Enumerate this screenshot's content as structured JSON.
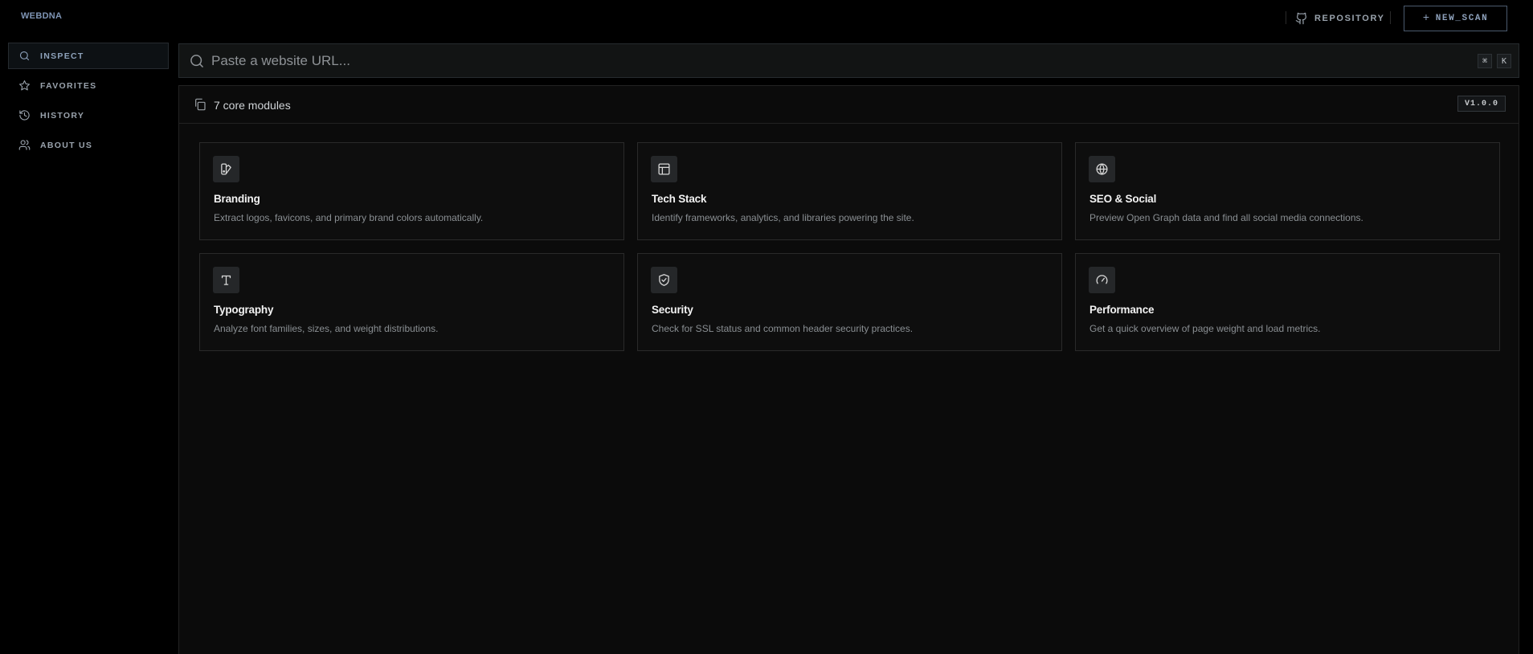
{
  "brand": "WEBDNA",
  "header": {
    "repository_label": "REPOSITORY",
    "new_scan_label": "NEW_SCAN",
    "new_scan_icon": "plus-icon",
    "repository_icon": "github-icon"
  },
  "sidebar": {
    "items": [
      {
        "label": "INSPECT",
        "icon": "search-icon",
        "active": true
      },
      {
        "label": "FAVORITES",
        "icon": "star-icon",
        "active": false
      },
      {
        "label": "HISTORY",
        "icon": "history-icon",
        "active": false
      },
      {
        "label": "ABOUT US",
        "icon": "users-icon",
        "active": false
      }
    ]
  },
  "search": {
    "placeholder": "Paste a website URL...",
    "value": "",
    "shortcut": [
      "⌘",
      "K"
    ]
  },
  "panel": {
    "title": "7 core modules",
    "version": "V1.0.0",
    "title_icon": "copy-icon"
  },
  "modules": [
    {
      "title": "Branding",
      "desc": "Extract logos, favicons, and primary brand colors automatically.",
      "icon": "swatch-icon"
    },
    {
      "title": "Tech Stack",
      "desc": "Identify frameworks, analytics, and libraries powering the site.",
      "icon": "layout-icon"
    },
    {
      "title": "SEO & Social",
      "desc": "Preview Open Graph data and find all social media connections.",
      "icon": "globe-icon"
    },
    {
      "title": "Typography",
      "desc": "Analyze font families, sizes, and weight distributions.",
      "icon": "type-icon"
    },
    {
      "title": "Security",
      "desc": "Check for SSL status and common header security practices.",
      "icon": "shield-check-icon"
    },
    {
      "title": "Performance",
      "desc": "Get a quick overview of page weight and load metrics.",
      "icon": "gauge-icon"
    }
  ],
  "colors": {
    "background": "#000000",
    "panel": "#0b0b0b",
    "accent": "#8da0ba",
    "border": "#2a2a2a"
  }
}
